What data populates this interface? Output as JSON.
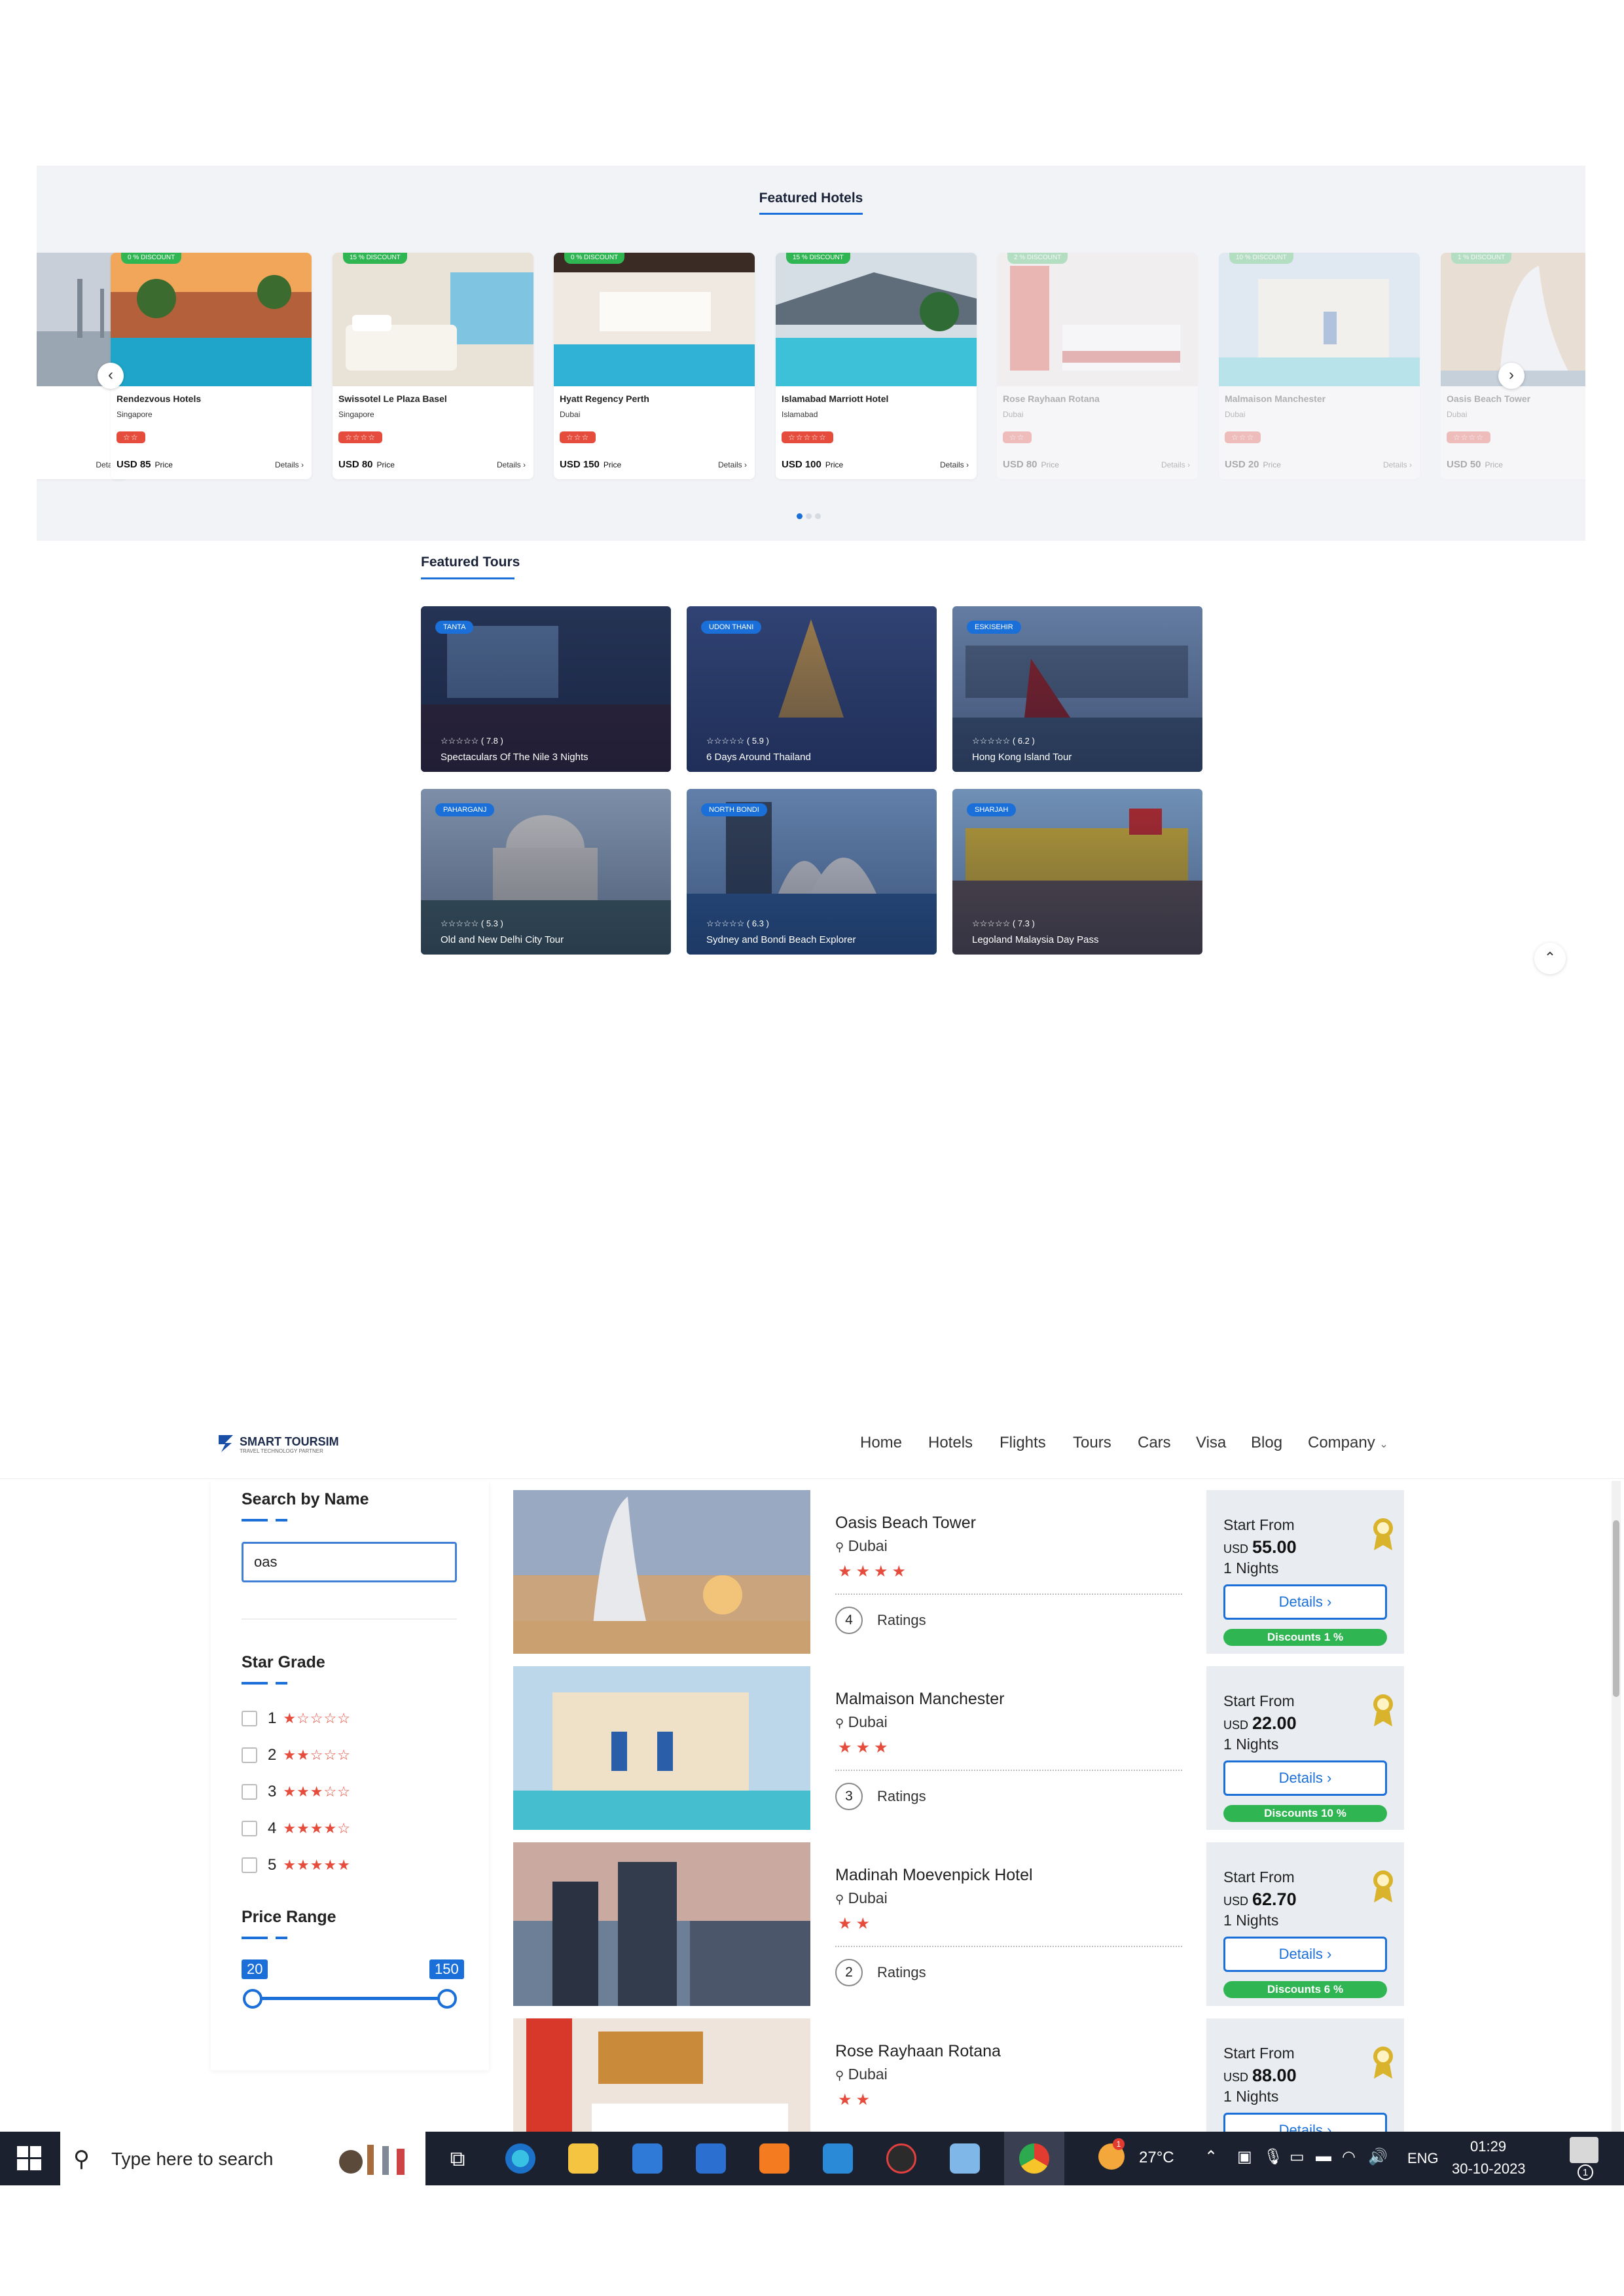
{
  "featured_hotels": {
    "title": "Featured Hotels",
    "hotels": [
      {
        "details": "Details"
      },
      {
        "discount": "0 % DISCOUNT",
        "name": "Rendezvous Hotels",
        "city": "Singapore",
        "stars": "☆☆",
        "price": "USD 85",
        "price_label": "Price",
        "details": "Details"
      },
      {
        "discount": "15 % DISCOUNT",
        "name": "Swissotel Le Plaza Basel",
        "city": "Singapore",
        "stars": "☆☆☆☆",
        "price": "USD 80",
        "price_label": "Price",
        "details": "Details"
      },
      {
        "discount": "0 % DISCOUNT",
        "name": "Hyatt Regency Perth",
        "city": "Dubai",
        "stars": "☆☆☆",
        "price": "USD 150",
        "price_label": "Price",
        "details": "Details"
      },
      {
        "discount": "15 % DISCOUNT",
        "name": "Islamabad Marriott Hotel",
        "city": "Islamabad",
        "stars": "☆☆☆☆☆",
        "price": "USD 100",
        "price_label": "Price",
        "details": "Details"
      },
      {
        "discount": "2 % DISCOUNT",
        "name": "Rose Rayhaan Rotana",
        "city": "Dubai",
        "stars": "☆☆",
        "price": "USD 80",
        "price_label": "Price",
        "details": "Details"
      },
      {
        "discount": "10 % DISCOUNT",
        "name": "Malmaison Manchester",
        "city": "Dubai",
        "stars": "☆☆☆",
        "price": "USD 20",
        "price_label": "Price",
        "details": "Details"
      },
      {
        "discount": "1 % DISCOUNT",
        "name": "Oasis Beach Tower",
        "city": "Dubai",
        "stars": "☆☆☆☆",
        "price": "USD 50",
        "price_label": "Price"
      }
    ],
    "prev_icon": "chevron-left-icon",
    "next_icon": "chevron-right-icon",
    "dots": 3,
    "active_dot": 1
  },
  "featured_tours": {
    "title": "Featured Tours",
    "tours": [
      {
        "location": "TANTA",
        "rating": "☆☆☆☆☆ ( 7.8 )",
        "name": "Spectaculars Of The Nile 3 Nights"
      },
      {
        "location": "UDON THANI",
        "rating": "☆☆☆☆☆ ( 5.9 )",
        "name": "6 Days Around Thailand"
      },
      {
        "location": "ESKISEHIR",
        "rating": "☆☆☆☆☆ ( 6.2 )",
        "name": "Hong Kong Island Tour"
      },
      {
        "location": "PAHARGANJ",
        "rating": "☆☆☆☆☆ ( 5.3 )",
        "name": "Old and New Delhi City Tour"
      },
      {
        "location": "NORTH BONDI",
        "rating": "☆☆☆☆☆ ( 6.3 )",
        "name": "Sydney and Bondi Beach Explorer"
      },
      {
        "location": "SHARJAH",
        "rating": "☆☆☆☆☆ ( 7.3 )",
        "name": "Legoland Malaysia Day Pass"
      }
    ],
    "scroll_top_icon": "chevron-up-icon"
  },
  "site": {
    "logo_text": "SMART TOURSIM",
    "logo_tagline": "TRAVEL TECHNOLOGY PARTNER",
    "nav": [
      "Home",
      "Hotels",
      "Flights",
      "Tours",
      "Cars",
      "Visa",
      "Blog",
      "Company"
    ]
  },
  "filters": {
    "search_title": "Search by Name",
    "search_value": "oas",
    "star_title": "Star Grade",
    "star_options": [
      {
        "label": "1",
        "stars": "★☆☆☆☆"
      },
      {
        "label": "2",
        "stars": "★★☆☆☆"
      },
      {
        "label": "3",
        "stars": "★★★☆☆"
      },
      {
        "label": "4",
        "stars": "★★★★☆"
      },
      {
        "label": "5",
        "stars": "★★★★★"
      }
    ],
    "price_title": "Price Range",
    "price_min": "20",
    "price_max": "150"
  },
  "results": [
    {
      "name": "Oasis Beach Tower",
      "city": "Dubai",
      "stars": "★★★★",
      "rating_count": "4",
      "ratings_label": "Ratings",
      "start_from": "Start From",
      "currency": "USD",
      "price": "55.00",
      "nights": "1 Nights",
      "details": "Details ›",
      "discount": "Discounts 1 %"
    },
    {
      "name": "Malmaison Manchester",
      "city": "Dubai",
      "stars": "★★★",
      "rating_count": "3",
      "ratings_label": "Ratings",
      "start_from": "Start From",
      "currency": "USD",
      "price": "22.00",
      "nights": "1 Nights",
      "details": "Details ›",
      "discount": "Discounts 10 %"
    },
    {
      "name": "Madinah Moevenpick Hotel",
      "city": "Dubai",
      "stars": "★★",
      "rating_count": "2",
      "ratings_label": "Ratings",
      "start_from": "Start From",
      "currency": "USD",
      "price": "62.70",
      "nights": "1 Nights",
      "details": "Details ›",
      "discount": "Discounts 6 %"
    },
    {
      "name": "Rose Rayhaan Rotana",
      "city": "Dubai",
      "stars": "★★",
      "start_from": "Start From",
      "currency": "USD",
      "price": "88.00",
      "nights": "1 Nights",
      "details": "Details ›"
    }
  ],
  "taskbar": {
    "search_placeholder": "Type here to search",
    "temperature": "27°C",
    "language": "ENG",
    "time": "01:29",
    "date": "30-10-2023",
    "notification_count": "1",
    "weather_badge": "1",
    "icons": [
      "windows-start-icon",
      "search-icon",
      "task-view-icon",
      "edge-icon",
      "file-explorer-icon",
      "store-icon",
      "mail-icon",
      "xampp-icon",
      "vscode-icon",
      "screen-recorder-icon",
      "notepad-icon",
      "chrome-icon"
    ]
  },
  "colors": {
    "accent": "#1a6fd8",
    "discount_green": "#30b553",
    "star_red": "#e64c3c",
    "taskbar": "#1c2130"
  }
}
